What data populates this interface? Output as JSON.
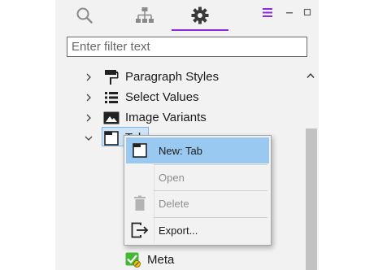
{
  "toolbar": {
    "icons": [
      "search-icon",
      "hierarchy-icon",
      "gear-icon",
      "hamburger-menu-icon",
      "minimize-icon",
      "maximize-icon"
    ]
  },
  "filter": {
    "placeholder": "Enter filter text",
    "value": ""
  },
  "tree": {
    "items": [
      {
        "label": "Paragraph Styles",
        "icon": "paragraph-style-icon",
        "state": "collapsed"
      },
      {
        "label": "Select Values",
        "icon": "list-icon",
        "state": "collapsed"
      },
      {
        "label": "Image Variants",
        "icon": "image-icon",
        "state": "collapsed"
      },
      {
        "label": "Tab",
        "icon": "tab-icon",
        "state": "expanded",
        "selected": true
      },
      {
        "label": "Meta",
        "icon": "meta-check-icon"
      }
    ]
  },
  "context_menu": {
    "items": [
      {
        "label": "New: Tab",
        "icon": "tab-icon",
        "enabled": true,
        "highlighted": true
      },
      {
        "label": "Open",
        "icon": "",
        "enabled": false
      },
      {
        "label": "Delete",
        "icon": "trash-icon",
        "enabled": false
      },
      {
        "label": "Export...",
        "icon": "export-icon",
        "enabled": true
      }
    ]
  },
  "colors": {
    "accent": "#8a2be2",
    "panel_bg": "#f2f2f2",
    "menu_highlight": "#99c9f0",
    "selection_bg": "#cfe3f7",
    "disabled_text": "#8e8e8e"
  }
}
